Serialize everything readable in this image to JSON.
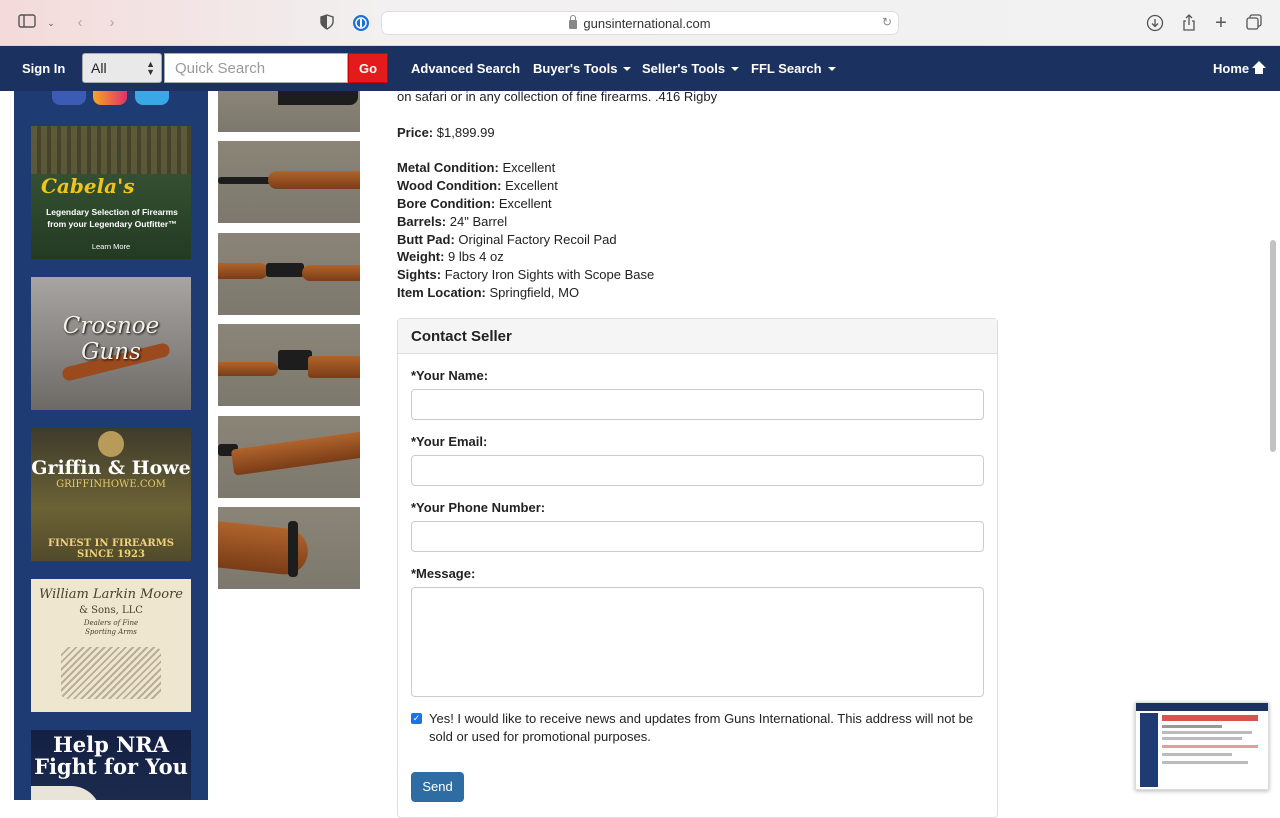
{
  "browser": {
    "url": "gunsinternational.com"
  },
  "nav": {
    "sign_in": "Sign In",
    "category_select": "All",
    "search_placeholder": "Quick Search",
    "go_label": "Go",
    "advanced_search": "Advanced Search",
    "buyers_tools": "Buyer's Tools",
    "sellers_tools": "Seller's Tools",
    "ffl_search": "FFL Search",
    "home": "Home"
  },
  "ads": {
    "cabelas_logo": "Cabela's",
    "cabelas_text": "Legendary Selection of Firearms from your Legendary Outfitter™",
    "cabelas_cta": "Learn More",
    "crosnoe": "Crosnoe Guns",
    "griffin_title": "Griffin & Howe",
    "griffin_url": "GRIFFINHOWE.COM",
    "griffin_tag1": "FINEST IN FIREARMS",
    "griffin_tag2": "SINCE 1923",
    "moore_title": "William Larkin Moore",
    "moore_sub": "& Sons, LLC",
    "moore_tag": "Dealers of Fine Sporting Arms",
    "nra_line1": "Help NRA",
    "nra_line2": "Fight for You"
  },
  "listing": {
    "intro": "on safari or in any collection of fine firearms. .416 Rigby",
    "price_label": "Price:",
    "price_value": "$1,899.99",
    "specs": [
      {
        "label": "Metal Condition:",
        "value": "Excellent"
      },
      {
        "label": "Wood Condition:",
        "value": "Excellent"
      },
      {
        "label": "Bore Condition:",
        "value": "Excellent"
      },
      {
        "label": "Barrels:",
        "value": "24\" Barrel"
      },
      {
        "label": "Butt Pad:",
        "value": "Original Factory Recoil Pad"
      },
      {
        "label": "Weight:",
        "value": "9 lbs 4 oz"
      },
      {
        "label": "Sights:",
        "value": "Factory Iron Sights with Scope Base"
      },
      {
        "label": "Item Location:",
        "value": "Springfield, MO"
      }
    ]
  },
  "contact": {
    "title": "Contact Seller",
    "name_label": "*Your Name:",
    "email_label": "*Your Email:",
    "phone_label": "*Your Phone Number:",
    "message_label": "*Message:",
    "optin_checked": true,
    "optin_text": "Yes! I would like to receive news and updates from Guns International. This address will not be sold or used for promotional purposes.",
    "send_label": "Send"
  },
  "colors": {
    "nav_bg": "#1b3160",
    "ad_column_bg": "#1f3b73",
    "go_button": "#e41b1b",
    "send_button": "#2e6da4"
  }
}
